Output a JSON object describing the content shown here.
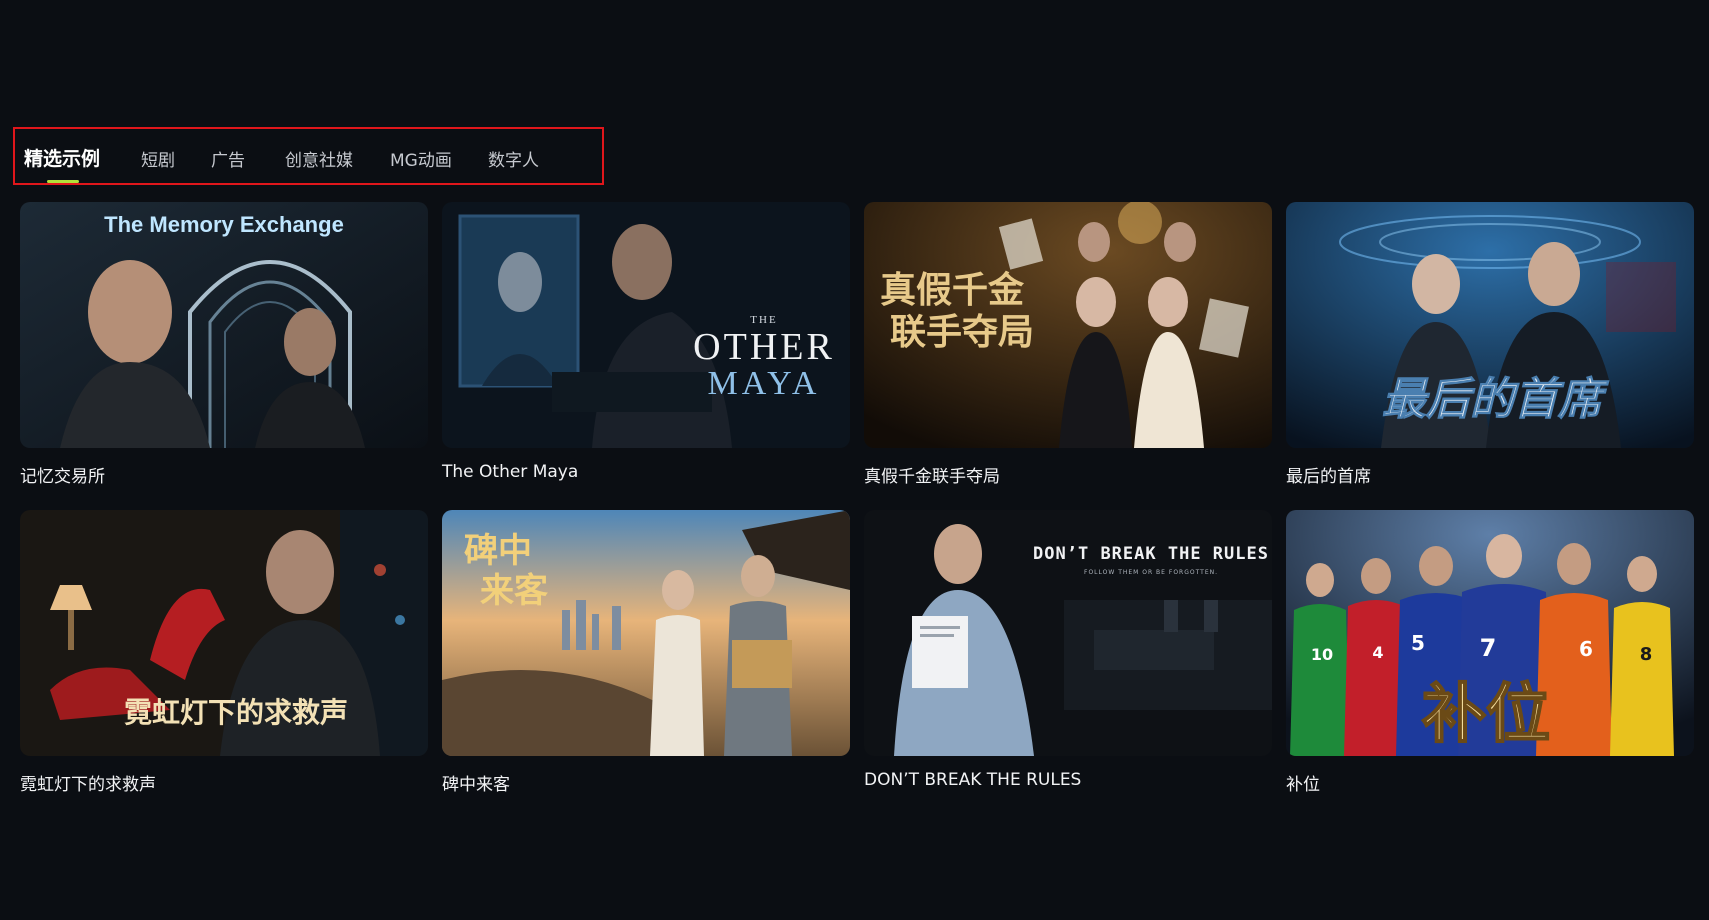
{
  "tabs": [
    {
      "label": "精选示例",
      "active": true
    },
    {
      "label": "短剧",
      "active": false
    },
    {
      "label": "广告",
      "active": false
    },
    {
      "label": "创意社媒",
      "active": false
    },
    {
      "label": "MG动画",
      "active": false
    },
    {
      "label": "数字人",
      "active": false
    }
  ],
  "accent_color": "#b3e03a",
  "highlight_border_color": "#e0161b",
  "cards": [
    {
      "title": "记忆交易所",
      "poster_text": "The Memory Exchange"
    },
    {
      "title": "The Other Maya",
      "poster_small": "THE",
      "poster_line1": "OTHER",
      "poster_line2": "MAYA"
    },
    {
      "title": "真假千金联手夺局",
      "poster_line1": "真假千金",
      "poster_line2": "联手夺局"
    },
    {
      "title": "最后的首席",
      "poster_text": "最后的首席"
    },
    {
      "title": "霓虹灯下的求救声",
      "poster_text": "霓虹灯下的求救声"
    },
    {
      "title": "碑中来客",
      "poster_line1": "碑中",
      "poster_line2": "来客"
    },
    {
      "title": "DON’T BREAK THE RULES",
      "poster_text": "DON’T BREAK THE RULES",
      "poster_sub": "FOLLOW THEM OR BE FORGOTTEN."
    },
    {
      "title": "补位",
      "poster_text": "补位",
      "jersey_numbers": [
        "10",
        "4",
        "5",
        "7",
        "6",
        "8"
      ]
    }
  ]
}
